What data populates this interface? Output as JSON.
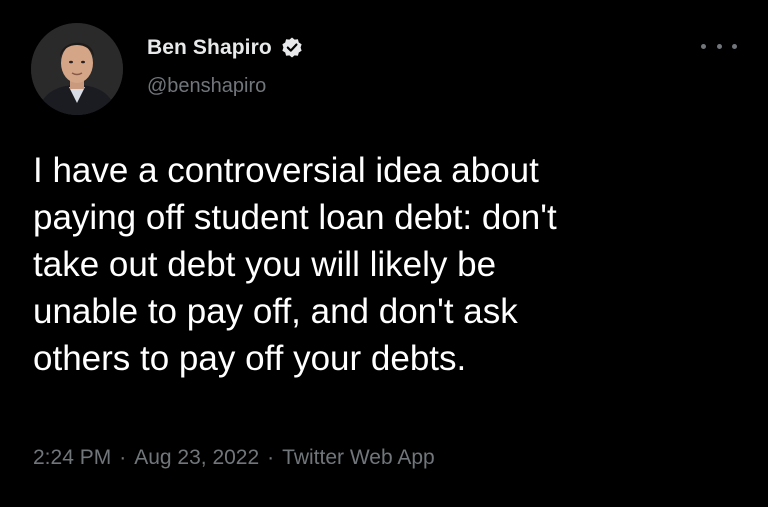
{
  "author": {
    "display_name": "Ben Shapiro",
    "handle": "@benshapiro",
    "verified": true
  },
  "tweet": {
    "text": "I have a controversial idea about\npaying off student loan debt: don't\ntake out debt you will likely be\nunable to pay off, and don't ask\nothers to pay off your debts."
  },
  "meta": {
    "time": "2:24 PM",
    "date": "Aug 23, 2022",
    "source": "Twitter Web App",
    "separator": "·"
  },
  "icons": {
    "verified": "verified-badge-icon",
    "more": "more-horizontal-icon"
  },
  "colors": {
    "background": "#000000",
    "text_primary": "#ffffff",
    "text_secondary": "#71767b"
  }
}
